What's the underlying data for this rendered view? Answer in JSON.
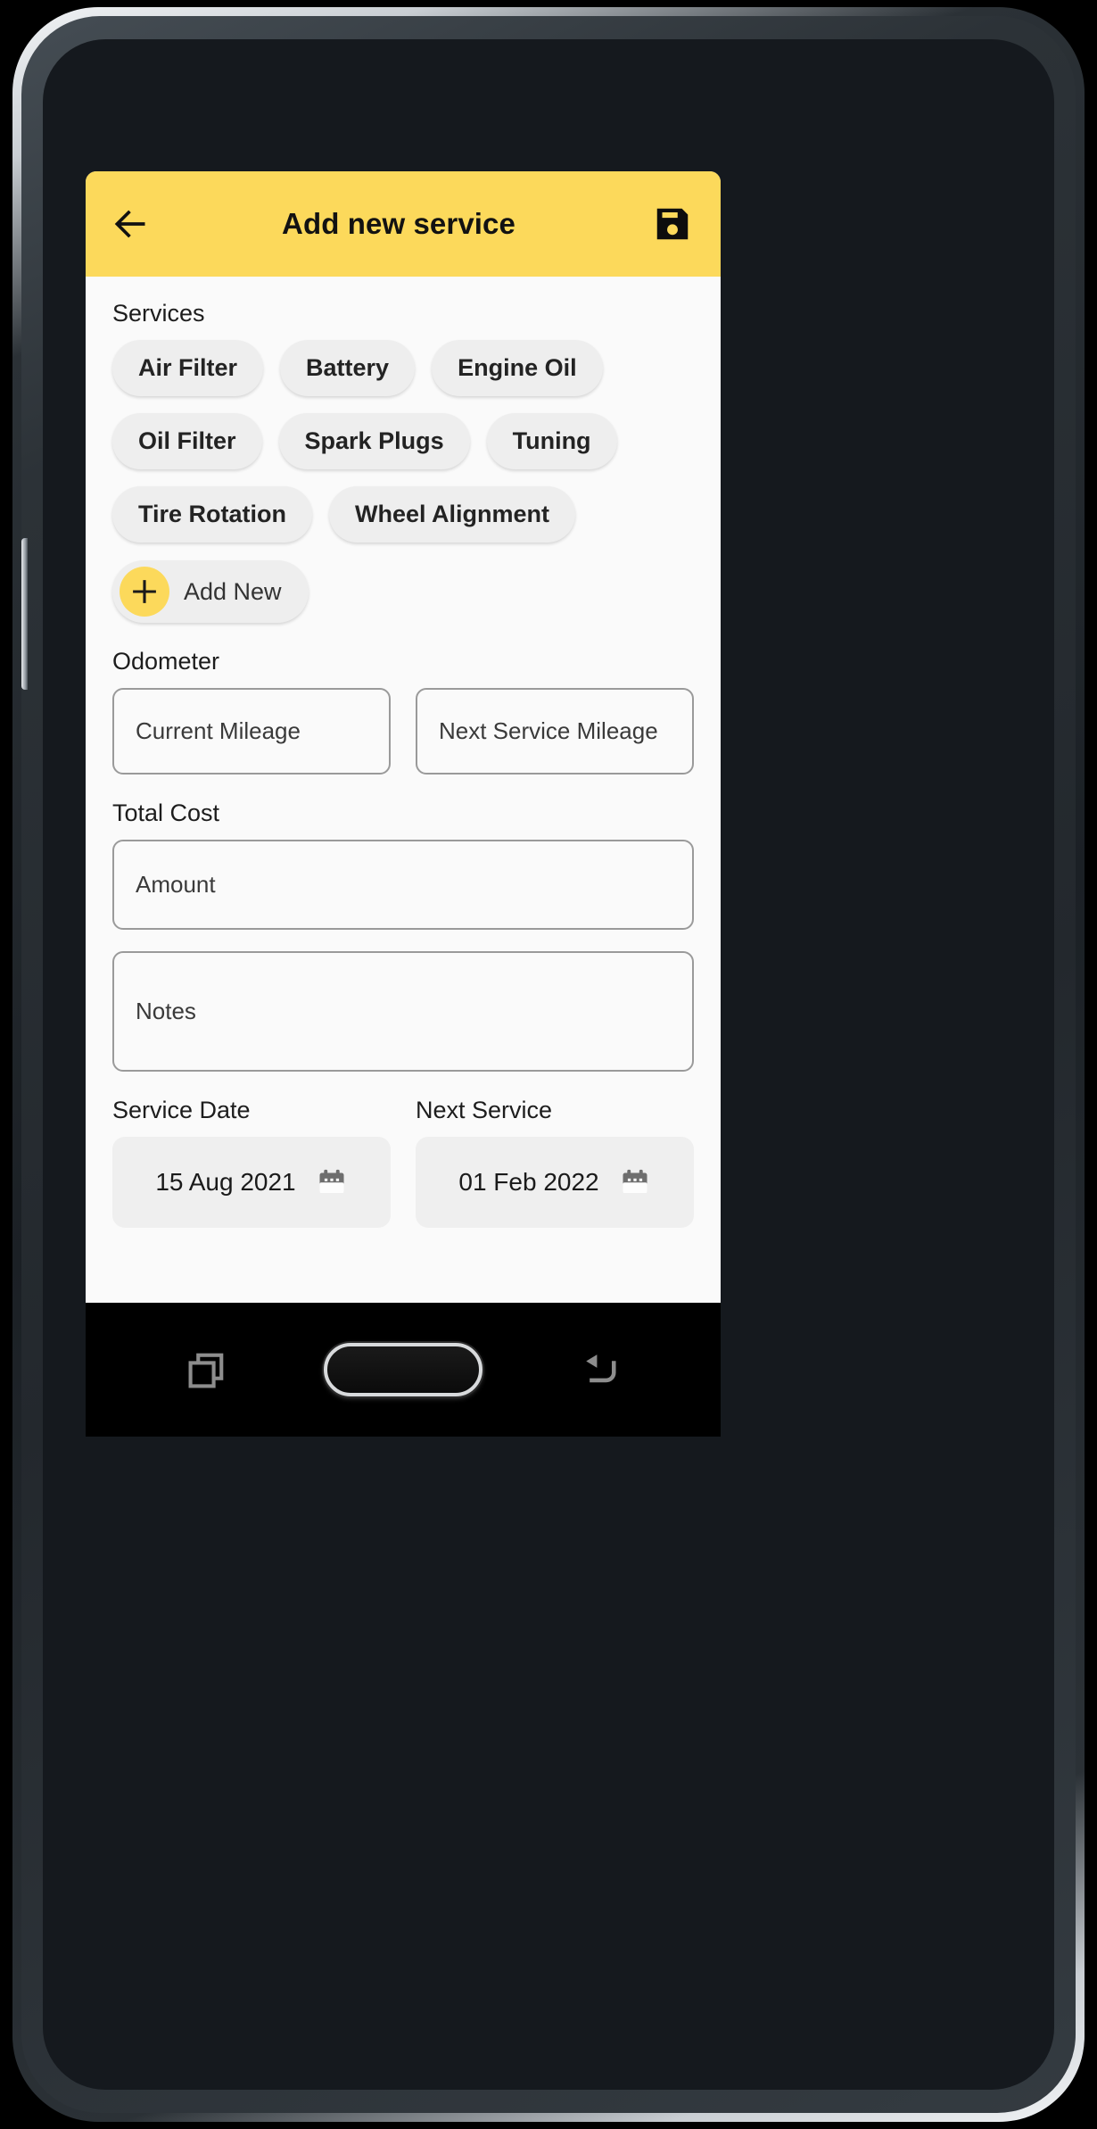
{
  "app_bar": {
    "title": "Add new service",
    "back_icon": "arrow-left-icon",
    "save_icon": "save-floppy-icon",
    "background_color": "#fcd95b"
  },
  "services": {
    "label": "Services",
    "chips": [
      "Air Filter",
      "Battery",
      "Engine Oil",
      "Oil Filter",
      "Spark Plugs",
      "Tuning",
      "Tire Rotation",
      "Wheel Alignment"
    ],
    "add_new": {
      "label": "Add New",
      "icon": "plus-icon",
      "icon_background": "#fcd95b"
    }
  },
  "odometer": {
    "label": "Odometer",
    "current_mileage_placeholder": "Current Mileage",
    "current_mileage_value": "",
    "next_service_mileage_placeholder": "Next Service Mileage",
    "next_service_mileage_value": ""
  },
  "total_cost": {
    "label": "Total Cost",
    "amount_placeholder": "Amount",
    "amount_value": ""
  },
  "notes": {
    "placeholder": "Notes",
    "value": ""
  },
  "dates": {
    "service_date_label": "Service Date",
    "service_date_value": "15 Aug 2021",
    "next_service_label": "Next Service",
    "next_service_value": "01 Feb 2022",
    "calendar_icon": "calendar-icon"
  },
  "nav_bar": {
    "recents_icon": "recents-icon",
    "home_icon": "home-key",
    "back_icon": "back-arrow-icon"
  }
}
